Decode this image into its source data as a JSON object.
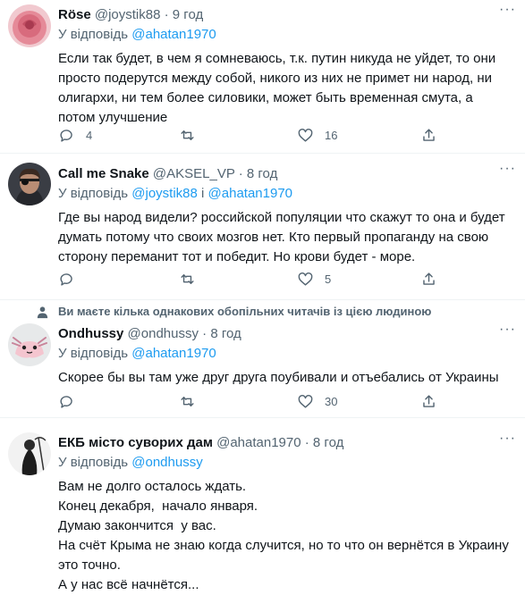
{
  "tweets": [
    {
      "name": "Röse",
      "handle": "@joystik88",
      "time": "9 год",
      "reply_prefix": "У відповідь",
      "reply_to": "@ahatan1970",
      "reply_joiner": "",
      "reply_to_2": "",
      "text": [
        "Если так будет, в чем я сомневаюсь, т.к. путин никуда не уйдет, то они",
        "просто подерутся между собой, никого из них не примет ни народ, ни",
        "олигархи, ни тем более силовики, может быть временная смута, а",
        "потом улучшение"
      ],
      "replies": "4",
      "retweets": "",
      "likes": "16"
    },
    {
      "name": "Call me Snake",
      "handle": "@AKSEL_VP",
      "time": "8 год",
      "reply_prefix": "У відповідь",
      "reply_to": "@joystik88",
      "reply_joiner": "і",
      "reply_to_2": "@ahatan1970",
      "text": [
        "Где вы народ видели? российской популяции что скажут то она и будет",
        "думать потому что своих мозгов нет. Кто первый пропаганду на свою",
        "сторону переманит тот и победит. Но крови будет - море."
      ],
      "replies": "",
      "retweets": "",
      "likes": "5"
    },
    {
      "name": "Ondhussy",
      "handle": "@ondhussy",
      "time": "8 год",
      "reply_prefix": "У відповідь",
      "reply_to": "@ahatan1970",
      "reply_joiner": "",
      "reply_to_2": "",
      "text": [
        "Скорее бы вы там уже друг друга поубивали и отъебались от Украины"
      ],
      "replies": "",
      "retweets": "",
      "likes": "30"
    },
    {
      "name": "ЕКБ місто суворих дам",
      "handle": "@ahatan1970",
      "time": "8 год",
      "reply_prefix": "У відповідь",
      "reply_to": "@ondhussy",
      "reply_joiner": "",
      "reply_to_2": "",
      "text": [
        "Вам не долго осталось ждать.",
        "Конец декабря,  начало января.",
        "Думаю закончится  у вас.",
        "На счёт Крыма не знаю когда случится, но то что он вернётся в Украину",
        "это точно.",
        "А у нас всё начнётся..."
      ],
      "replies": "",
      "retweets": "",
      "likes": ""
    }
  ],
  "notice": {
    "text": "Ви маєте кілька однакових обопільних читачів із цією людиною"
  },
  "more_label": "···",
  "colors": {
    "accent": "#1d9bf0",
    "secondary": "#536471",
    "text": "#0f1419",
    "divider": "#eff3f4"
  },
  "icons": [
    "reply-icon",
    "retweet-icon",
    "like-icon",
    "share-icon",
    "more-icon",
    "person-icon"
  ]
}
